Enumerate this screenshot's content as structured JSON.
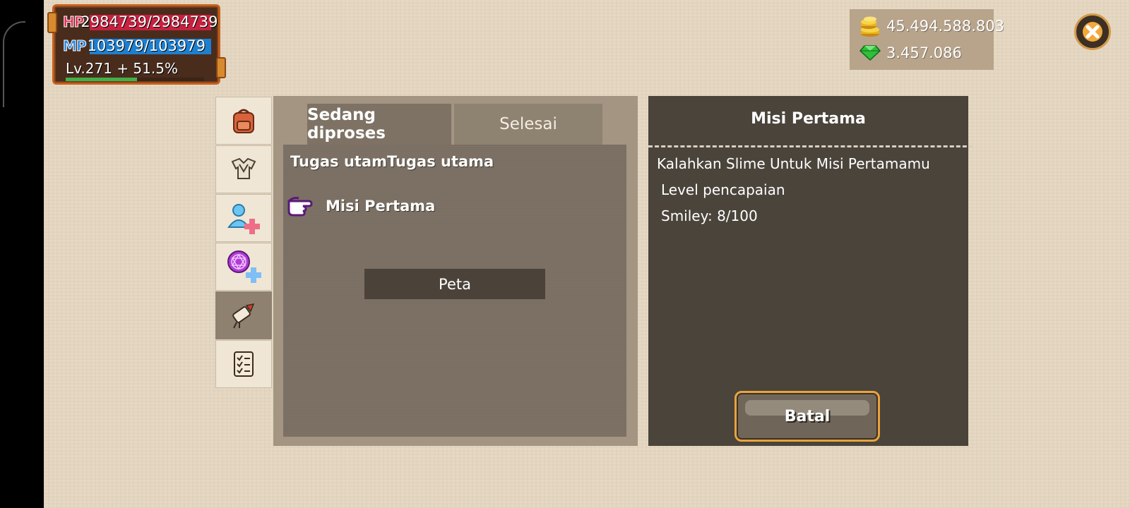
{
  "player": {
    "hp_label": "HP",
    "hp_value": "2984739/2984739",
    "mp_label": "MP",
    "mp_value": "103979/103979",
    "level_text": "Lv.271 + 51.5%",
    "level_progress": 0.515
  },
  "currency": {
    "gold": "45.494.588.803",
    "gems": "3.457.086"
  },
  "side_tabs": [
    {
      "icon": "backpack-icon",
      "active": false
    },
    {
      "icon": "armor-icon",
      "active": false
    },
    {
      "icon": "add-character-icon",
      "active": false
    },
    {
      "icon": "magic-circle-add-icon",
      "active": false
    },
    {
      "icon": "quest-scroll-icon",
      "active": true
    },
    {
      "icon": "checklist-icon",
      "active": false
    }
  ],
  "quest_tabs": {
    "in_progress": "Sedang diproses",
    "completed": "Selesai"
  },
  "quest_list": {
    "heading": "Tugas utamTugas utama",
    "item": "Misi Pertama",
    "map_button": "Peta"
  },
  "detail": {
    "title": "Misi Pertama",
    "description": "Kalahkan Slime Untuk Misi Pertamamu",
    "requirement": "Level pencapaian",
    "progress": "Smiley: 8/100",
    "cancel_button": "Batal"
  },
  "colors": {
    "hp": "#c8213f",
    "mp": "#1d7fd0",
    "level_bar": "#3fb24a",
    "button_border": "#e9a33c"
  }
}
